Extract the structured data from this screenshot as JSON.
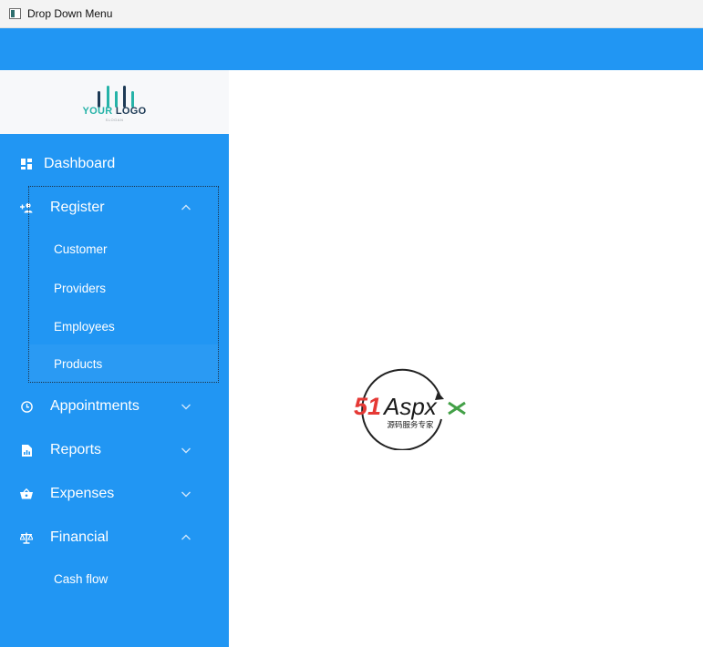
{
  "window": {
    "title": "Drop Down Menu"
  },
  "logo": {
    "word_1": "YOUR",
    "word_2": "LOGO",
    "slogan": "SLOGAN",
    "bar_color": "#26b3a8"
  },
  "sidebar": {
    "bg_color": "#2196f3",
    "items": [
      {
        "label": "Dashboard",
        "icon": "dashboard-icon",
        "expandable": false
      },
      {
        "label": "Register",
        "icon": "add-user-icon",
        "expandable": true,
        "expanded": true,
        "sub_items": [
          {
            "label": "Customer"
          },
          {
            "label": "Providers"
          },
          {
            "label": "Employees"
          },
          {
            "label": "Products"
          }
        ]
      },
      {
        "label": "Appointments",
        "icon": "clock-icon",
        "expandable": true,
        "expanded": false
      },
      {
        "label": "Reports",
        "icon": "report-icon",
        "expandable": true,
        "expanded": false
      },
      {
        "label": "Expenses",
        "icon": "basket-icon",
        "expandable": true,
        "expanded": false
      },
      {
        "label": "Financial",
        "icon": "balance-icon",
        "expandable": true,
        "expanded": true,
        "sub_items": [
          {
            "label": "Cash flow"
          }
        ]
      }
    ]
  },
  "watermark": {
    "brand_num": "51",
    "brand_text": "Aspx",
    "tagline": "源码服务专家"
  }
}
